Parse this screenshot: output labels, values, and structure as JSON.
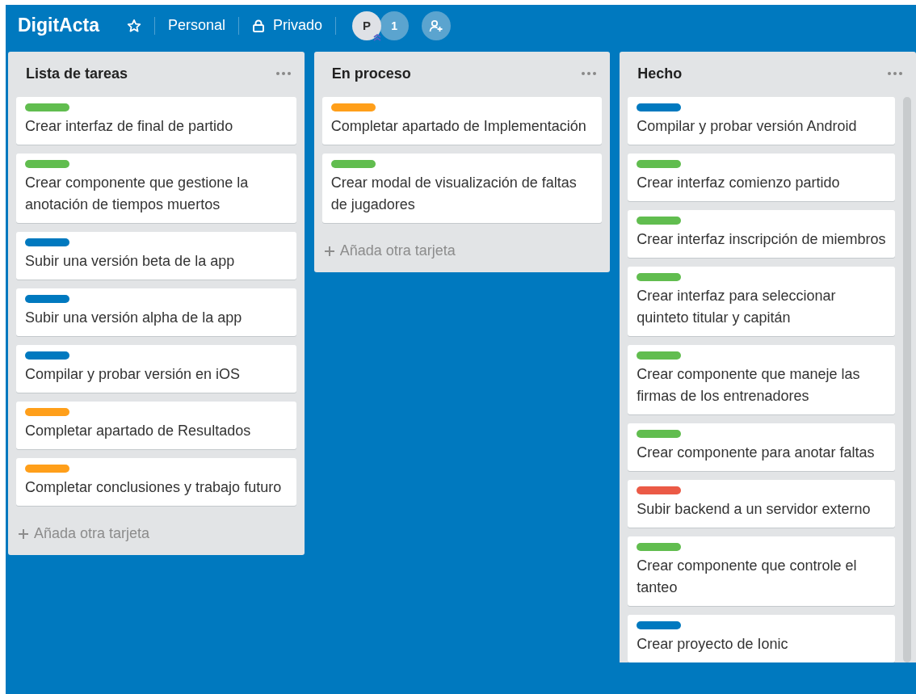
{
  "header": {
    "title": "DigitActa",
    "team": "Personal",
    "visibility": "Privado",
    "avatar": "P",
    "member_count": "1"
  },
  "lists": [
    {
      "title": "Lista de tareas",
      "add_label": "Añada otra tarjeta",
      "cards": [
        {
          "text": "Crear interfaz de final de partido",
          "color": "#61bd4f"
        },
        {
          "text": "Crear componente que gestione la anotación de tiempos muertos",
          "color": "#61bd4f"
        },
        {
          "text": "Subir una versión beta de la app",
          "color": "#0079bf"
        },
        {
          "text": "Subir una versión alpha de la app",
          "color": "#0079bf"
        },
        {
          "text": "Compilar y probar versión en iOS",
          "color": "#0079bf"
        },
        {
          "text": "Completar apartado de Resultados",
          "color": "#ff9f1a"
        },
        {
          "text": "Completar conclusiones y trabajo futuro",
          "color": "#ff9f1a"
        }
      ]
    },
    {
      "title": "En proceso",
      "add_label": "Añada otra tarjeta",
      "cards": [
        {
          "text": "Completar apartado de Implementación",
          "color": "#ff9f1a"
        },
        {
          "text": "Crear modal de visualización de faltas de jugadores",
          "color": "#61bd4f"
        }
      ]
    },
    {
      "title": "Hecho",
      "cards": [
        {
          "text": "Compilar y probar versión Android",
          "color": "#0079bf"
        },
        {
          "text": "Crear interfaz comienzo partido",
          "color": "#61bd4f"
        },
        {
          "text": "Crear interfaz inscripción de miembros",
          "color": "#61bd4f"
        },
        {
          "text": "Crear interfaz para seleccionar quinteto titular y capitán",
          "color": "#61bd4f"
        },
        {
          "text": "Crear componente que maneje las firmas de los entrenadores",
          "color": "#61bd4f"
        },
        {
          "text": "Crear componente para anotar faltas",
          "color": "#61bd4f"
        },
        {
          "text": "Subir backend a un servidor externo",
          "color": "#eb5a46"
        },
        {
          "text": "Crear componente que controle el tanteo",
          "color": "#61bd4f"
        },
        {
          "text": "Crear proyecto de Ionic",
          "color": "#0079bf"
        }
      ]
    }
  ]
}
